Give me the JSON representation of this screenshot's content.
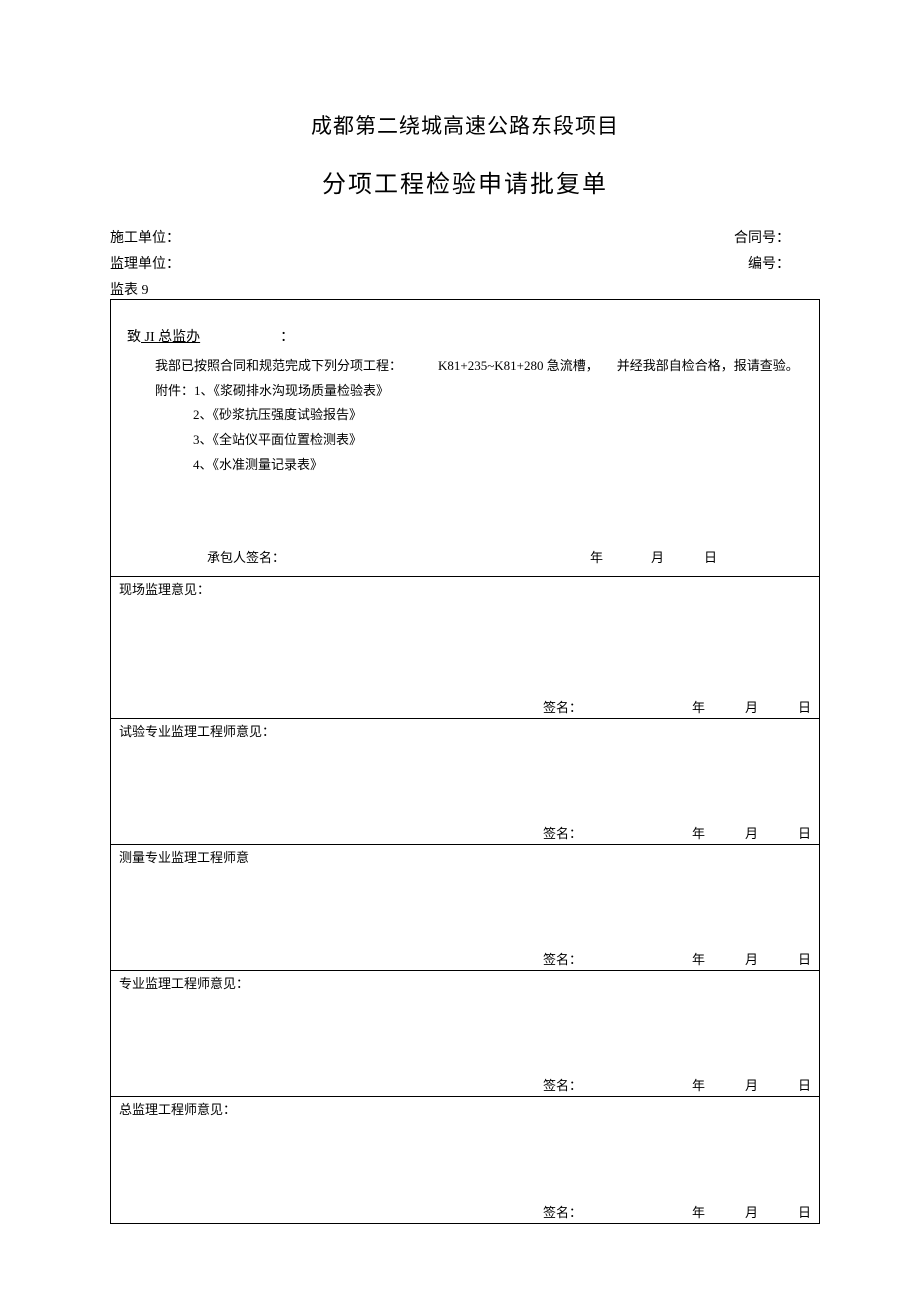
{
  "title": "成都第二绕城高速公路东段项目",
  "subtitle": "分项工程检验申请批复单",
  "header": {
    "construction_unit_label": "施工单位：",
    "contract_no_label": "合同号：",
    "supervision_unit_label": "监理单位：",
    "serial_no_label": "编号："
  },
  "table_label": "监表 9",
  "section1": {
    "to_prefix": "致",
    "addressee": " JI 总监办",
    "colon": "：",
    "line1_a": "我部已按照合同和规范完成下列分项工程：",
    "line1_b": "K81+235~K81+280 急流槽，",
    "line1_c": "并经我部自检合格，报请查验。",
    "attach_label": "附件：",
    "attachments": [
      "1、《浆砌排水沟现场质量检验表》",
      "2、《砂浆抗压强度试验报告》",
      "3、《全站仪平面位置检测表》",
      "4、《水准测量记录表》"
    ],
    "contractor_sig_label": "承包人签名：",
    "year": "年",
    "month": "月",
    "day": "日"
  },
  "opinions": [
    {
      "title": "现场监理意见："
    },
    {
      "title": "试验专业监理工程师意见："
    },
    {
      "title": "测量专业监理工程师意"
    },
    {
      "title": "专业监理工程师意见："
    },
    {
      "title": "总监理工程师意见："
    }
  ],
  "signature_label": "签名：",
  "ymd": {
    "year": "年",
    "month": "月",
    "day": "日"
  }
}
